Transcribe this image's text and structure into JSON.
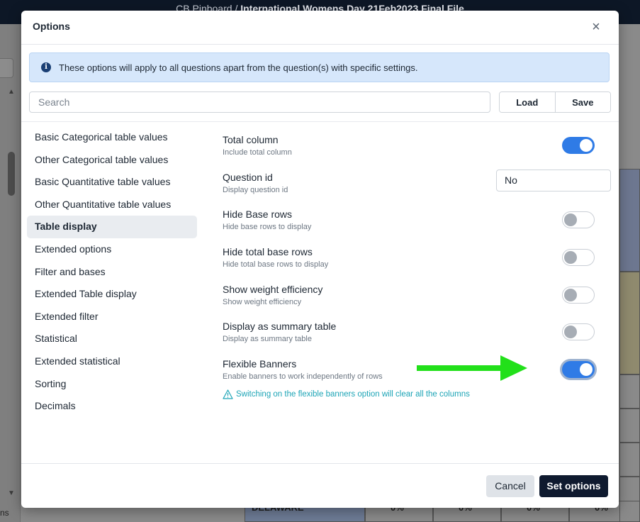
{
  "background": {
    "topbar_prefix": "CB Pinboard",
    "topbar_separator": "/",
    "topbar_title": "International Womens Day 21Feb2023 Final File",
    "row_label": "DELAWARE",
    "row_values": [
      "0%",
      "0%",
      "0%",
      "0%"
    ],
    "left_cut_text": "ns"
  },
  "modal": {
    "title": "Options",
    "close_icon": "×",
    "info_text": "These options will apply to all questions apart from the question(s) with specific settings.",
    "search_placeholder": "Search",
    "load_label": "Load",
    "save_label": "Save"
  },
  "sidebar": {
    "items": [
      {
        "label": "Basic Categorical table values",
        "active": false
      },
      {
        "label": "Other Categorical table values",
        "active": false
      },
      {
        "label": "Basic Quantitative table values",
        "active": false
      },
      {
        "label": "Other Quantitative table values",
        "active": false
      },
      {
        "label": "Table display",
        "active": true
      },
      {
        "label": "Extended options",
        "active": false
      },
      {
        "label": "Filter and bases",
        "active": false
      },
      {
        "label": "Extended Table display",
        "active": false
      },
      {
        "label": "Extended filter",
        "active": false
      },
      {
        "label": "Statistical",
        "active": false
      },
      {
        "label": "Extended statistical",
        "active": false
      },
      {
        "label": "Sorting",
        "active": false
      },
      {
        "label": "Decimals",
        "active": false
      }
    ]
  },
  "settings": {
    "rows": [
      {
        "title": "Total column",
        "subtitle": "Include total column",
        "control": "toggle",
        "on": true
      },
      {
        "title": "Question id",
        "subtitle": "Display question id",
        "control": "select",
        "value": "No"
      },
      {
        "title": "Hide Base rows",
        "subtitle": "Hide base rows to display",
        "control": "toggle",
        "on": false
      },
      {
        "title": "Hide total base rows",
        "subtitle": "Hide total base rows to display",
        "control": "toggle",
        "on": false
      },
      {
        "title": "Show weight efficiency",
        "subtitle": "Show weight efficiency",
        "control": "toggle",
        "on": false
      },
      {
        "title": "Display as summary table",
        "subtitle": "Display as summary table",
        "control": "toggle",
        "on": false
      },
      {
        "title": "Flexible Banners",
        "subtitle": "Enable banners to work independently of rows",
        "control": "toggle",
        "on": true,
        "focused": true
      }
    ],
    "warning": "Switching on the flexible banners option will clear all the columns"
  },
  "footer": {
    "cancel_label": "Cancel",
    "submit_label": "Set options"
  },
  "colors": {
    "accent": "#2f7be6",
    "primary_button": "#0f1a2f",
    "warning_text": "#1ca4b6",
    "annotation_arrow": "#22e01a",
    "info_background": "#d6e7fb"
  },
  "icons": {
    "info": "info-circle-icon",
    "close": "close-icon",
    "warning": "warning-triangle-icon",
    "annotation": "green-arrow-annotation",
    "scroll_up": "scroll-up-arrow-icon",
    "scroll_down": "scroll-down-arrow-icon"
  }
}
